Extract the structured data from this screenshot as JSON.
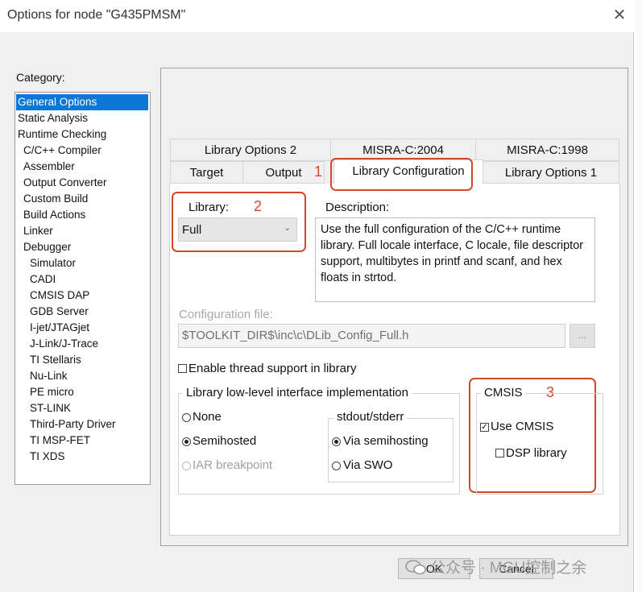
{
  "window": {
    "title": "Options for node \"G435PMSM\"",
    "close_glyph": "✕"
  },
  "category": {
    "label": "Category:",
    "items": [
      {
        "label": "General Options",
        "selected": true
      },
      {
        "label": "Static Analysis"
      },
      {
        "label": "Runtime Checking"
      },
      {
        "label": "C/C++ Compiler"
      },
      {
        "label": "Assembler"
      },
      {
        "label": "Output Converter"
      },
      {
        "label": "Custom Build"
      },
      {
        "label": "Build Actions"
      },
      {
        "label": "Linker"
      },
      {
        "label": "Debugger"
      },
      {
        "label": "Simulator"
      },
      {
        "label": "CADI"
      },
      {
        "label": "CMSIS DAP"
      },
      {
        "label": "GDB Server"
      },
      {
        "label": "I-jet/JTAGjet"
      },
      {
        "label": "J-Link/J-Trace"
      },
      {
        "label": "TI Stellaris"
      },
      {
        "label": "Nu-Link"
      },
      {
        "label": "PE micro"
      },
      {
        "label": "ST-LINK"
      },
      {
        "label": "Third-Party Driver"
      },
      {
        "label": "TI MSP-FET"
      },
      {
        "label": "TI XDS"
      }
    ]
  },
  "tabs": {
    "row1": [
      "Library Options 2",
      "MISRA-C:2004",
      "MISRA-C:1998"
    ],
    "row2": [
      "Target",
      "Output",
      "Library Configuration",
      "Library Options 1"
    ],
    "active": "Library Configuration"
  },
  "annotations": [
    "1",
    "2",
    "3"
  ],
  "library": {
    "label": "Library:",
    "value": "Full",
    "arrow_glyph": "⌄",
    "description_label": "Description:",
    "description": "Use the full configuration of the C/C++ runtime library. Full locale interface, C locale, file descriptor support, multibytes in printf and scanf, and hex floats in strtod."
  },
  "config_file": {
    "label": "Configuration file:",
    "value": "$TOOLKIT_DIR$\\inc\\c\\DLib_Config_Full.h",
    "browse_label": "..."
  },
  "thread_support": {
    "label": "Enable thread support in library",
    "checked": false
  },
  "lowlevel": {
    "legend": "Library low-level interface implementation",
    "options": [
      {
        "label": "None",
        "selected": false,
        "enabled": true
      },
      {
        "label": "Semihosted",
        "selected": true,
        "enabled": true
      },
      {
        "label": "IAR breakpoint",
        "selected": false,
        "enabled": false
      }
    ],
    "stdout": {
      "legend": "stdout/stderr",
      "options": [
        {
          "label": "Via semihosting",
          "selected": true
        },
        {
          "label": "Via SWO",
          "selected": false
        }
      ]
    }
  },
  "cmsis": {
    "legend": "CMSIS",
    "use_cmsis": {
      "label": "Use CMSIS",
      "checked": true
    },
    "dsp": {
      "label": "DSP library",
      "checked": false
    }
  },
  "buttons": {
    "ok": "OK",
    "cancel": "Cancel"
  },
  "watermark": "公众号 · MGU控制之余",
  "colors": {
    "selection": "#0a78d4",
    "annotation": "#d04a2a"
  }
}
